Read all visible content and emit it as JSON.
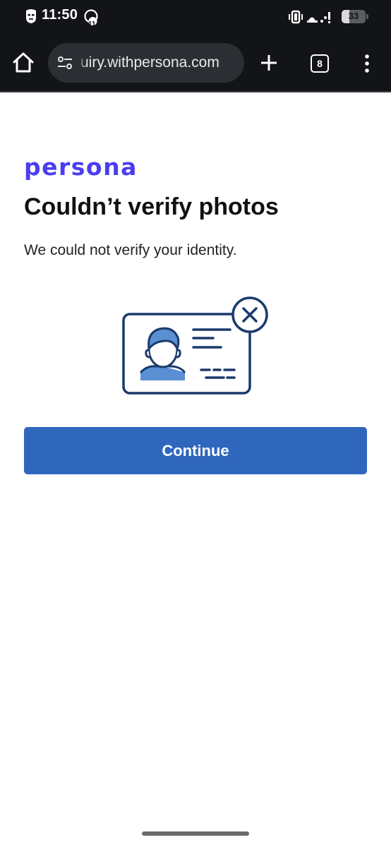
{
  "status_bar": {
    "time": "11:50",
    "notification_badge": "11",
    "battery_level": "33",
    "battery_fraction": 0.33
  },
  "browser": {
    "url": "uiry.withpersona.com",
    "tab_count": "8"
  },
  "page": {
    "logo_text": "persona",
    "title": "Couldn’t verify photos",
    "message": "We could not verify your identity.",
    "continue_label": "Continue"
  },
  "icons": {
    "home": "home-icon",
    "site_info": "site-info-icon",
    "new_tab": "plus-icon",
    "menu": "more-vertical-icon",
    "illustration": "id-card-error-illustration"
  },
  "colors": {
    "brand": "#4a3df0",
    "primary_button": "#2f67bd",
    "illustration_stroke": "#1b3a6b",
    "illustration_fill": "#5b8fd4",
    "chrome_background": "#121417"
  }
}
